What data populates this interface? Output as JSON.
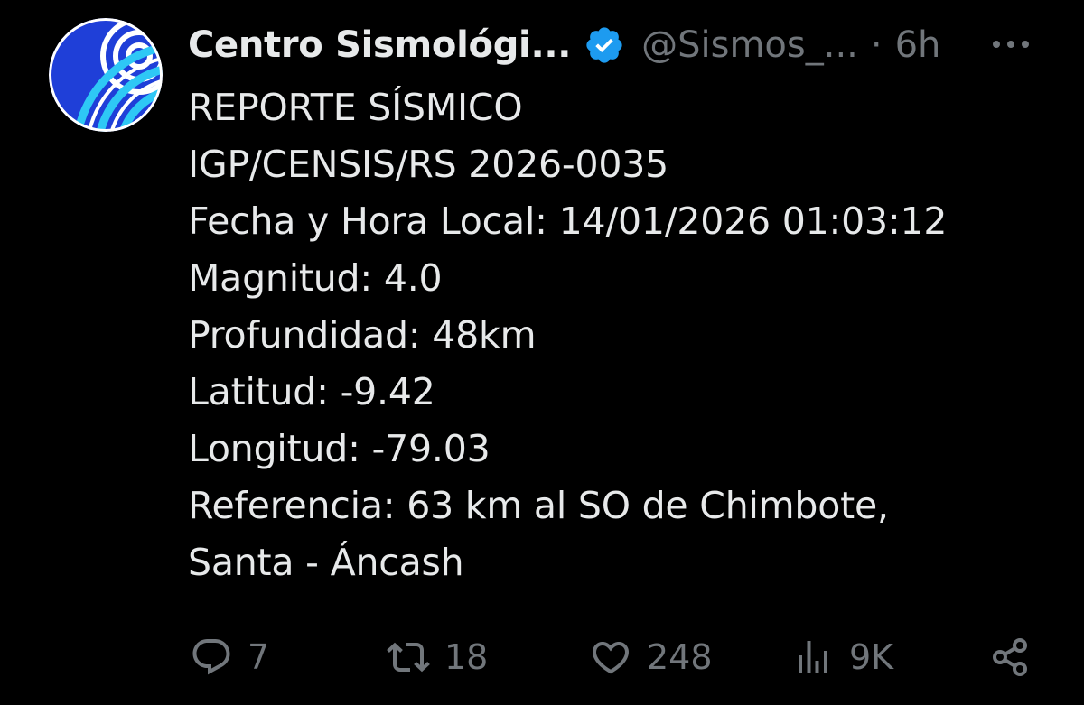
{
  "author": {
    "display_name": "Centro Sismológi...",
    "handle": "@Sismos_...",
    "separator": "·",
    "time": "6h",
    "verified": true,
    "avatar_icon": "seismology-logo-icon"
  },
  "tweet": {
    "lines": [
      "REPORTE SÍSMICO",
      "IGP/CENSIS/RS 2026-0035",
      "Fecha y Hora Local: 14/01/2026 01:03:12",
      "Magnitud: 4.0",
      "Profundidad: 48km",
      "Latitud: -9.42",
      "Longitud: -79.03",
      "Referencia: 63 km al SO de Chimbote,",
      "Santa - Áncash"
    ]
  },
  "actions": {
    "replies": "7",
    "retweets": "18",
    "likes": "248",
    "views": "9K"
  },
  "icons": {
    "more": "more-horizontal-icon",
    "reply": "reply-icon",
    "retweet": "retweet-icon",
    "like": "heart-icon",
    "views": "views-chart-icon",
    "share": "share-icon"
  },
  "colors": {
    "background": "#000000",
    "text_primary": "#e7e9ea",
    "text_secondary": "#71767b",
    "verified_badge": "#1d9bf0",
    "avatar_blue": "#1f4fe0",
    "avatar_cyan": "#2ec8f5"
  }
}
